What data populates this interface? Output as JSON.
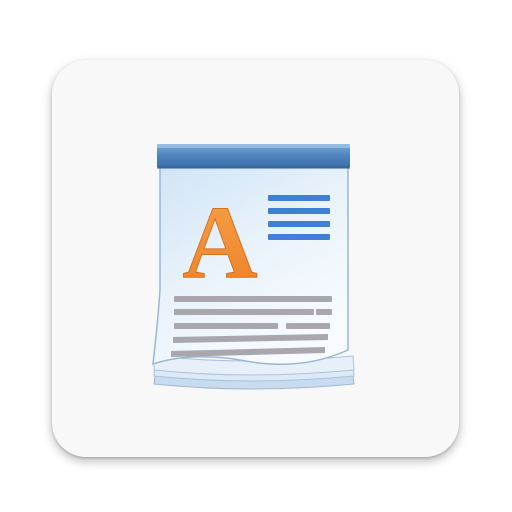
{
  "app_icon": {
    "glyph": "A",
    "name": "wordpad-icon",
    "colors": {
      "tile": "#f8f8f8",
      "header": "#5b8fc4",
      "page": "#dcebf8",
      "glyph": "#f2913a",
      "lines_blue": "#3f7fd6",
      "lines_gray": "#a7a7ad"
    }
  }
}
